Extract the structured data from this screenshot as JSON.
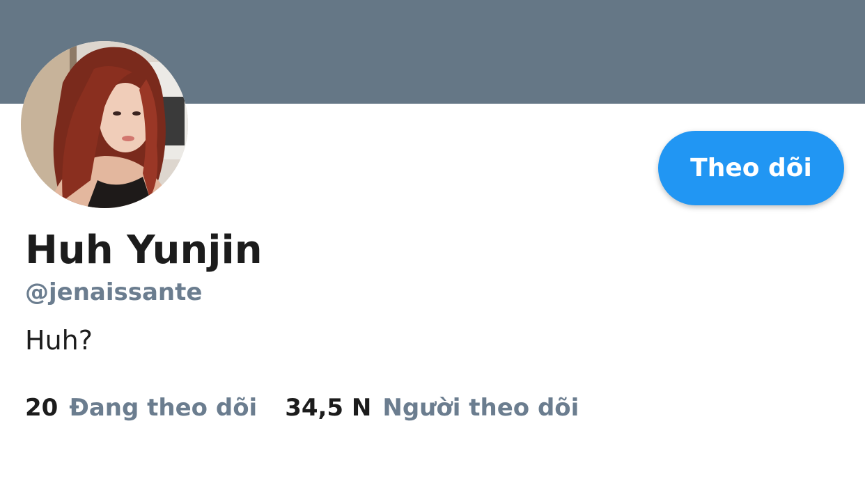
{
  "profile": {
    "display_name": "Huh Yunjin",
    "handle": "@jenaissante",
    "bio": "Huh?",
    "follow_button_label": "Theo dõi"
  },
  "stats": {
    "following_count": "20",
    "following_label": "Đang theo dõi",
    "followers_count": "34,5 N",
    "followers_label": "Người theo dõi"
  },
  "colors": {
    "banner": "#657786",
    "accent": "#2196f3",
    "secondary_text": "#6b7d8f",
    "primary_text": "#1c1c1c"
  }
}
